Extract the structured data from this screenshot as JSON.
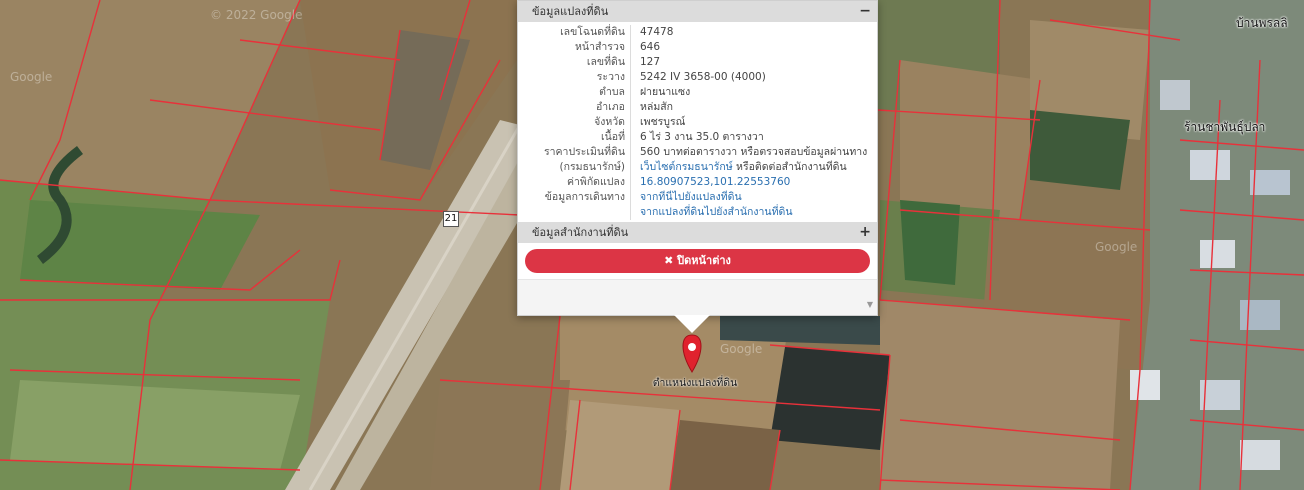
{
  "popup": {
    "section_title": "ข้อมูลแปลงที่ดิน",
    "section_toggle": "−",
    "fields": [
      {
        "label": "เลขโฉนดที่ดิน",
        "value": "47478"
      },
      {
        "label": "หน้าสำรวจ",
        "value": "646"
      },
      {
        "label": "เลขที่ดิน",
        "value": "127"
      },
      {
        "label": "ระวาง",
        "value": "5242 IV 3658-00 (4000)"
      },
      {
        "label": "ตำบล",
        "value": "ฝายนาแซง"
      },
      {
        "label": "อำเภอ",
        "value": "หล่มสัก"
      },
      {
        "label": "จังหวัด",
        "value": "เพชรบูรณ์"
      },
      {
        "label": "เนื้อที่",
        "value": "6 ไร่ 3 งาน 35.0 ตารางวา"
      },
      {
        "label": "ราคาประเมินที่ดิน",
        "value": "560 บาทต่อตารางวา หรือตรวจสอบข้อมูลผ่านทาง"
      }
    ],
    "appraisal_source_label": "(กรมธนารักษ์)",
    "appraisal_source_link": "เว็บไซต์กรมธนารักษ์",
    "appraisal_source_suffix": " หรือติดต่อสำนักงานที่ดิน",
    "coords_label": "ค่าพิกัดแปลง",
    "coords_value": "16.80907523,101.22553760",
    "directions_label": "ข้อมูลการเดินทาง",
    "directions_link_1": "จากที่นี่ไปยังแปลงที่ดิน",
    "directions_link_2": "จากแปลงที่ดินไปยังสำนักงานที่ดิน",
    "office_section_title": "ข้อมูลสำนักงานที่ดิน",
    "office_section_toggle": "+",
    "close_icon": "✖",
    "close_label": " ปิดหน้าต่าง"
  },
  "map": {
    "marker_label": "ตำแหน่งแปลงที่ดิน",
    "route_shield": "21",
    "place_1": "บ้านพรลลิ",
    "place_2": "ร้านชาพันธุ์ปลา",
    "watermark": "Google",
    "watermark_2": "© 2022 Google",
    "marker_color": "#e0222e",
    "parcel_line_color": "#e8313a"
  }
}
